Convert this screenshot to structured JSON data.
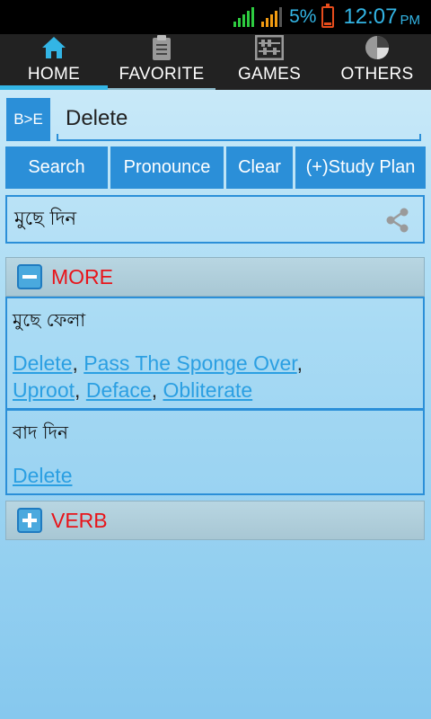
{
  "status_bar": {
    "battery_percent": "5%",
    "time": "12:07",
    "ampm": "PM"
  },
  "tabs": [
    {
      "label": "HOME",
      "icon": "home-icon"
    },
    {
      "label": "FAVORITE",
      "icon": "clipboard-icon"
    },
    {
      "label": "GAMES",
      "icon": "abacus-icon"
    },
    {
      "label": "OTHERS",
      "icon": "pie-icon"
    }
  ],
  "search": {
    "direction_label": "B>E",
    "word": "Delete"
  },
  "actions": {
    "search": "Search",
    "pronounce": "Pronounce",
    "clear": "Clear",
    "study_plan": "(+)Study Plan"
  },
  "meaning": {
    "text": "মুছে দিন"
  },
  "sections": {
    "more": {
      "title": "MORE",
      "entries": [
        {
          "bengali": "মুছে ফেলা",
          "synonyms": [
            "Delete",
            "Pass The Sponge Over",
            "Uproot",
            "Deface",
            "Obliterate"
          ]
        },
        {
          "bengali": "বাদ দিন",
          "synonyms": [
            "Delete"
          ]
        }
      ]
    },
    "verb": {
      "title": "VERB"
    }
  },
  "colors": {
    "accent": "#2b8fd8",
    "link": "#2b9fe2",
    "section_title": "#e8141a"
  }
}
